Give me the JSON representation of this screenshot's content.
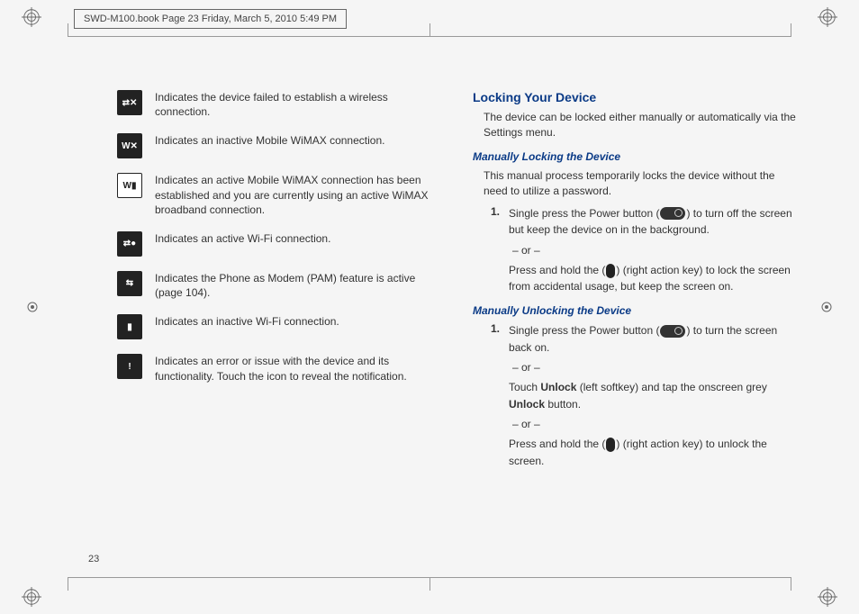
{
  "header": "SWD-M100.book  Page 23  Friday, March 5, 2010  5:49 PM",
  "page_number": "23",
  "icons": [
    {
      "glyph": "⇄✕",
      "name": "wireless-failed-icon",
      "desc": "Indicates the device failed to establish a wireless connection."
    },
    {
      "glyph": "W✕",
      "name": "wimax-inactive-icon",
      "desc": "Indicates an inactive Mobile WiMAX connection."
    },
    {
      "glyph": "W▮",
      "name": "wimax-active-icon",
      "desc": "Indicates an active Mobile WiMAX connection has been established and you are currently using an active WiMAX broadband connection."
    },
    {
      "glyph": "⇄●",
      "name": "wifi-active-icon",
      "desc": "Indicates an active Wi-Fi connection."
    },
    {
      "glyph": "⇆",
      "name": "pam-active-icon",
      "desc": "Indicates the Phone as Modem (PAM) feature is active (page 104)."
    },
    {
      "glyph": "▮",
      "name": "wifi-inactive-icon",
      "desc": "Indicates an inactive Wi-Fi connection."
    },
    {
      "glyph": "!",
      "name": "error-icon",
      "desc": "Indicates an error or issue with the device and its functionality. Touch the icon to reveal the notification."
    }
  ],
  "right": {
    "heading": "Locking Your Device",
    "intro": "The device can be locked either manually or automatically via the Settings menu.",
    "sub1": "Manually Locking the Device",
    "sub1_body": "This manual process temporarily locks the device without the need to utilize a password.",
    "step1_a": "Single press the Power button (",
    "step1_b": ") to turn off the screen but keep the device on in the background.",
    "or": "– or –",
    "step1_c": "Press and hold the (",
    "step1_d": ") (right action key) to lock the screen from accidental usage, but keep the screen on.",
    "sub2": "Manually Unlocking the Device",
    "unlock1_a": "Single press the Power button (",
    "unlock1_b": ") to turn the screen back on.",
    "unlock2_a": "Touch ",
    "unlock2_bold1": "Unlock",
    "unlock2_b": " (left softkey) and tap the onscreen grey ",
    "unlock2_bold2": "Unlock",
    "unlock2_c": " button.",
    "unlock3_a": "Press and hold the (",
    "unlock3_b": ") (right action key) to unlock the screen."
  }
}
